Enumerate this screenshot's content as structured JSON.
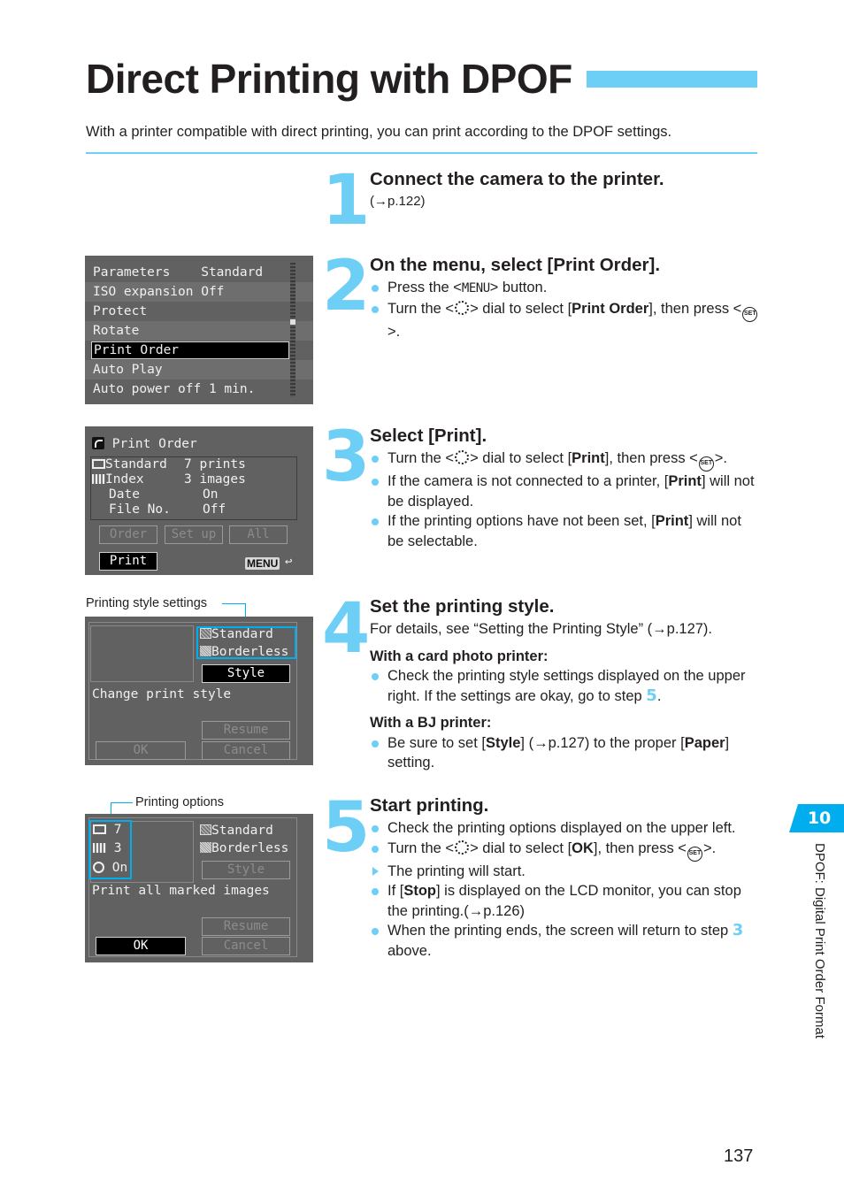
{
  "page": {
    "title": "Direct Printing with DPOF",
    "intro": "With a printer compatible with direct printing, you can print according to the DPOF settings.",
    "page_number": "137",
    "chapter_tab": "10",
    "chapter_label": "DPOF: Digital Print Order Format",
    "accent_color": "#6dcff6"
  },
  "steps": [
    {
      "number": "1",
      "heading": "Connect the camera to the printer.",
      "ref": "(→p.122)"
    },
    {
      "number": "2",
      "heading": "On the menu, select [Print Order].",
      "bullets": [
        {
          "pre": "Press the <",
          "kw": "MENU",
          "post": "> button."
        },
        {
          "pre": "Turn the <",
          "mid": "> dial to select [",
          "bold": "Print Order",
          "post": "], then press <",
          "end": ">."
        }
      ]
    },
    {
      "number": "3",
      "heading": "Select [Print].",
      "bullets": [
        {
          "pre": "Turn the <",
          "mid": "> dial to select [",
          "bold": "Print",
          "post": "], then press <",
          "end": ">."
        },
        {
          "pre": "If the camera is not connected to a printer, [",
          "bold": "Print",
          "post": "] will not be displayed."
        },
        {
          "pre": "If the printing options have not been set, [",
          "bold": "Print",
          "post": "] will not be selectable."
        }
      ]
    },
    {
      "number": "4",
      "heading": "Set the printing style.",
      "intro": "For details, see “Setting the Printing Style” (→p.127).",
      "sub1": "With a card photo printer:",
      "sub1_bullet": {
        "pre": "Check the printing style settings displayed on the upper right. If the settings are okay, go to step ",
        "ref": "5",
        "post": "."
      },
      "sub2": "With a BJ printer:",
      "sub2_bullet": {
        "pre": "Be sure to set [",
        "bold": "Style",
        "mid": "] (→p.127) to the proper [",
        "bold2": "Paper",
        "post": "] setting."
      }
    },
    {
      "number": "5",
      "heading": "Start printing.",
      "bullets": [
        {
          "pre": "Check the printing options displayed on the upper left."
        },
        {
          "pre": "Turn the <",
          "mid": "> dial to select [",
          "bold": "OK",
          "post": "], then press <",
          "end": ">."
        },
        {
          "pre": "The printing will start."
        },
        {
          "pre": "If [",
          "bold": "Stop",
          "post": "] is displayed on the LCD monitor, you can stop the printing.(→p.126)"
        },
        {
          "pre": "When the printing ends, the screen will return to step ",
          "ref": "3",
          "post": " above."
        }
      ]
    }
  ],
  "icons": {
    "dial": "main-dial-icon",
    "set": "SET"
  },
  "lcd_menu": {
    "rows": [
      {
        "label": "Parameters    Standard"
      },
      {
        "label": "ISO expansion Off"
      },
      {
        "label": "Protect"
      },
      {
        "label": "Rotate"
      },
      {
        "label": "Print Order",
        "selected": true
      },
      {
        "label": "Auto Play"
      },
      {
        "label": "Auto power off 1 min."
      }
    ]
  },
  "lcd_print_order": {
    "title": "Print Order",
    "rows": [
      {
        "label": "Standard",
        "value": "7 prints"
      },
      {
        "label": "Index",
        "value": "3 images"
      },
      {
        "label": "Date",
        "value": "On"
      },
      {
        "label": "File No.",
        "value": "Off"
      }
    ],
    "buttons": [
      "Order",
      "Set up",
      "All"
    ],
    "print_button": "Print",
    "menu_badge": "MENU",
    "return_icon": "↩"
  },
  "lcd_style": {
    "callout": "Printing style settings",
    "paper1": "Standard",
    "paper2": "Borderless",
    "style_button": "Style",
    "message": "Change print style",
    "resume_button": "Resume",
    "ok_button": "OK",
    "cancel_button": "Cancel"
  },
  "lcd_start": {
    "callout": "Printing options",
    "opt_prints": "7",
    "opt_index": "3",
    "opt_date": "On",
    "paper1": "Standard",
    "paper2": "Borderless",
    "style_button": "Style",
    "message": "Print all marked images",
    "resume_button": "Resume",
    "ok_button": "OK",
    "cancel_button": "Cancel"
  }
}
